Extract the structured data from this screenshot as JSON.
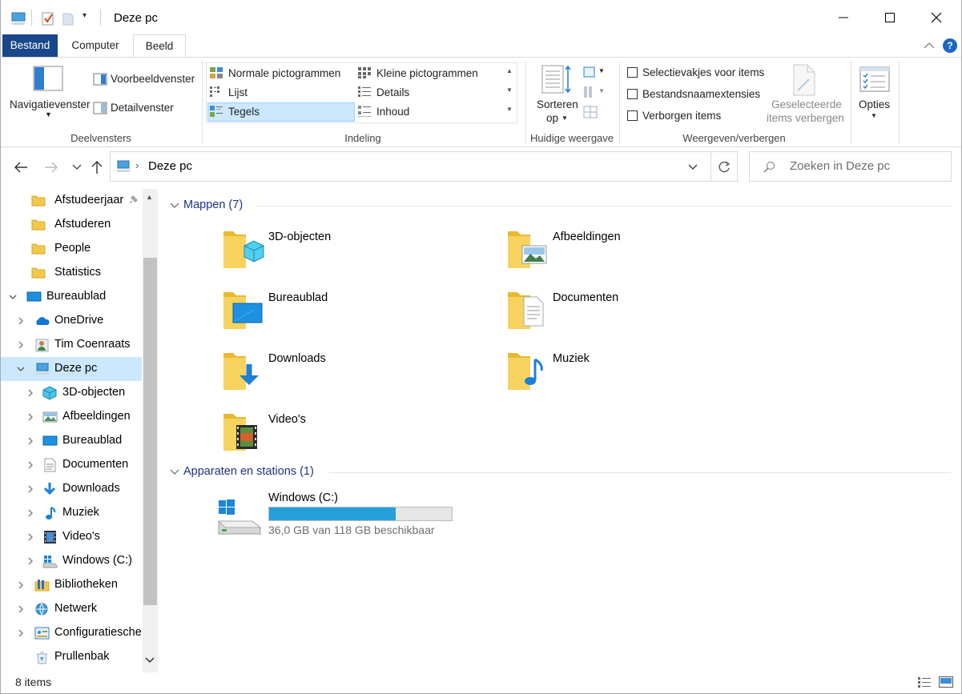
{
  "window": {
    "title": "Deze pc"
  },
  "ribbon_tabs": [
    "Bestand",
    "Computer",
    "Beeld"
  ],
  "ribbon": {
    "panes": {
      "nav_label": "Navigatievenster",
      "preview": "Voorbeeldvenster",
      "details": "Detailvenster",
      "group": "Deelvensters"
    },
    "layout": {
      "items": [
        "Normale pictogrammen",
        "Kleine pictogrammen",
        "Lijst",
        "Details",
        "Tegels",
        "Inhoud"
      ],
      "group": "Indeling"
    },
    "current_view": {
      "sort_label_1": "Sorteren",
      "sort_label_2": "op",
      "group": "Huidige weergave"
    },
    "show_hide": {
      "checkboxes": [
        "Selectievakjes voor items",
        "Bestandsnaamextensies",
        "Verborgen items"
      ],
      "hide_1": "Geselecteerde",
      "hide_2": "items verbergen",
      "group": "Weergeven/verbergen"
    },
    "options": "Opties"
  },
  "address": {
    "path": "Deze pc",
    "search_placeholder": "Zoeken in Deze pc"
  },
  "tree": [
    {
      "label": "Afstudeerjaar",
      "icon": "folder-icon"
    },
    {
      "label": "Afstuderen",
      "icon": "folder-icon"
    },
    {
      "label": "People",
      "icon": "folder-icon"
    },
    {
      "label": "Statistics",
      "icon": "folder-icon"
    },
    {
      "label": "Bureaublad",
      "icon": "desktop-icon"
    },
    {
      "label": "OneDrive",
      "icon": "onedrive-icon"
    },
    {
      "label": "Tim Coenraats",
      "icon": "user-icon"
    },
    {
      "label": "Deze pc",
      "icon": "this-pc-icon"
    },
    {
      "label": "3D-objecten",
      "icon": "3d-objects-icon"
    },
    {
      "label": "Afbeeldingen",
      "icon": "pictures-icon"
    },
    {
      "label": "Bureaublad",
      "icon": "desktop-icon"
    },
    {
      "label": "Documenten",
      "icon": "documents-icon"
    },
    {
      "label": "Downloads",
      "icon": "downloads-icon"
    },
    {
      "label": "Muziek",
      "icon": "music-icon"
    },
    {
      "label": "Video's",
      "icon": "videos-icon"
    },
    {
      "label": "Windows (C:)",
      "icon": "drive-icon"
    },
    {
      "label": "Bibliotheken",
      "icon": "libraries-icon"
    },
    {
      "label": "Netwerk",
      "icon": "network-icon"
    },
    {
      "label": "Configuratiesche",
      "icon": "control-panel-icon"
    },
    {
      "label": "Prullenbak",
      "icon": "recycle-bin-icon"
    }
  ],
  "groups": {
    "folders": "Mappen (7)",
    "devices": "Apparaten en stations (1)"
  },
  "folders": [
    "3D-objecten",
    "Afbeeldingen",
    "Bureaublad",
    "Documenten",
    "Downloads",
    "Muziek",
    "Video's"
  ],
  "drive": {
    "name": "Windows (C:)",
    "free_text": "36,0 GB van 118 GB beschikbaar",
    "used_fraction": 0.695
  },
  "status": {
    "count": "8 items"
  },
  "colors": {
    "accent": "#19478a",
    "selection": "#cce8ff",
    "drive_bar": "#26a0da",
    "group_header": "#1e3287"
  }
}
